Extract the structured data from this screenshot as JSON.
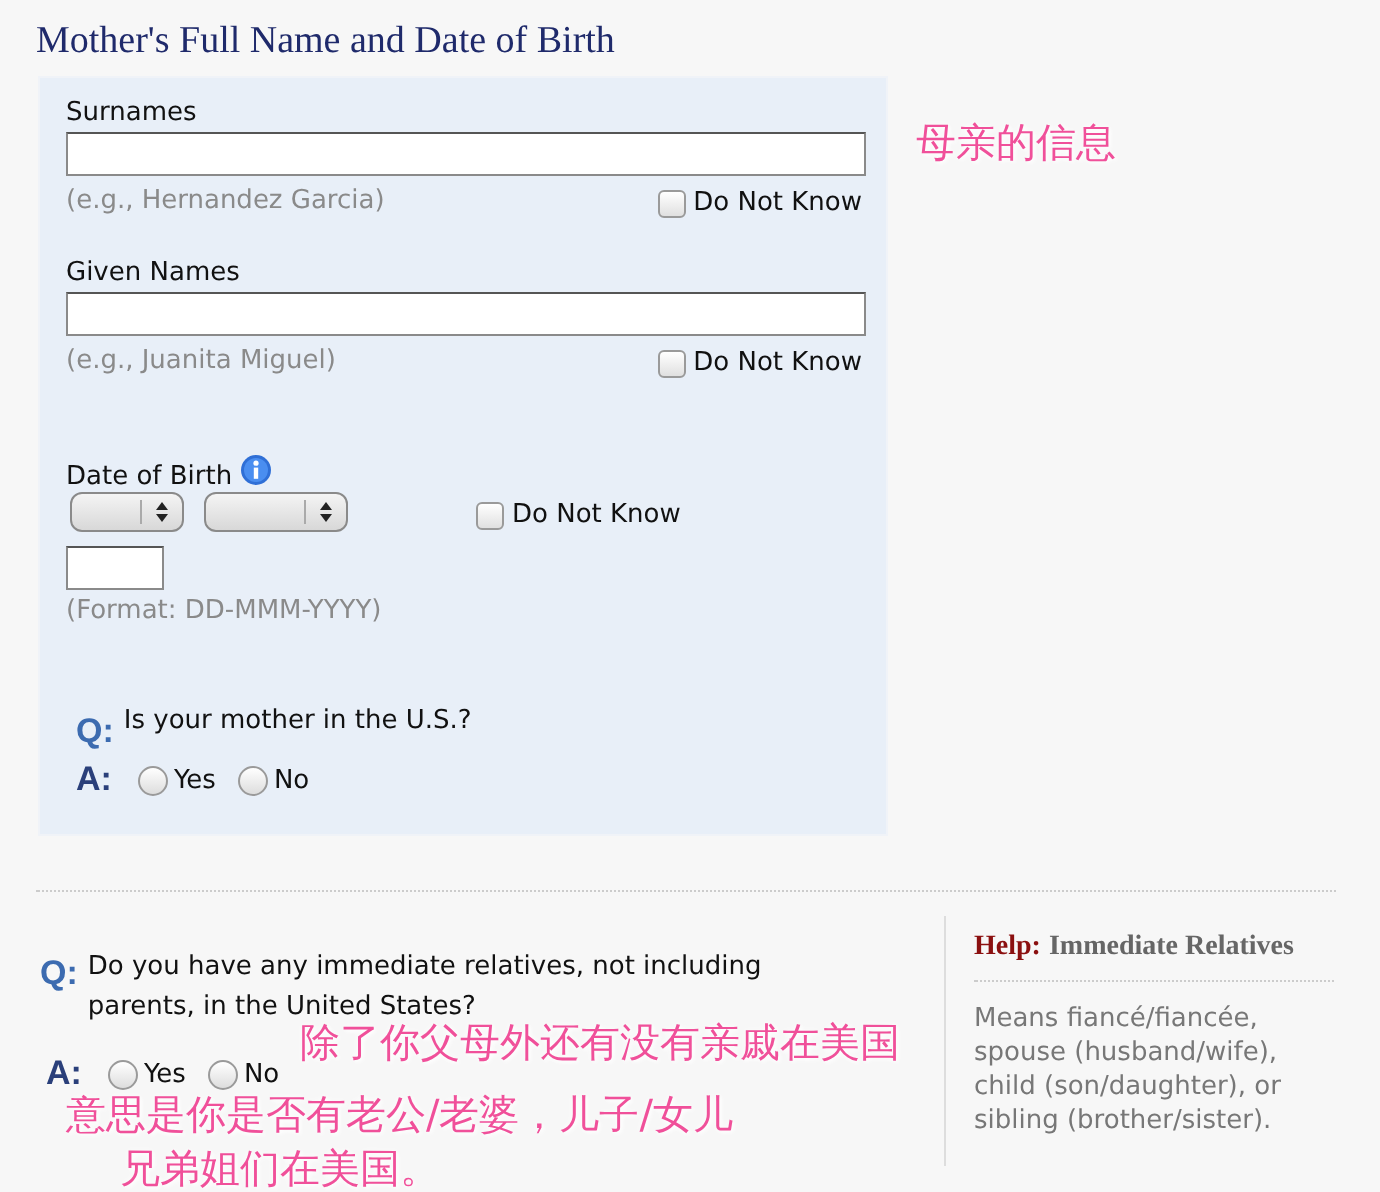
{
  "section_title": "Mother's Full Name and Date of Birth",
  "mother": {
    "fields": [
      {
        "label": "Surnames",
        "hint": "(e.g., Hernandez Garcia)",
        "dont_know": {
          "label": "Do Not Know",
          "checked": false
        }
      },
      {
        "label": "Given Names",
        "hint": "(e.g., Juanita Miguel)",
        "dont_know": {
          "label": "Do Not Know",
          "checked": false
        }
      }
    ],
    "dob": {
      "label": "Date of Birth",
      "dont_know": {
        "label": "Do Not Know",
        "checked": false
      },
      "format": "(Format: DD-MMM-YYYY)"
    },
    "question": {
      "q": "Q:",
      "text": "Is your mother in the U.S.?",
      "a": "A:",
      "options": [
        {
          "label": "Yes",
          "selected": false
        },
        {
          "label": "No",
          "selected": false
        }
      ]
    }
  },
  "relatives": {
    "question": {
      "q": "Q:",
      "text": "Do you have any immediate relatives, not including parents, in the United States?",
      "a": "A:",
      "options": [
        {
          "label": "Yes",
          "selected": false
        },
        {
          "label": "No",
          "selected": false
        }
      ]
    },
    "help": {
      "prefix": "Help:",
      "title": "Immediate Relatives",
      "text": "Means fiancé/fiancée, spouse (husband/wife), child (son/daughter), or sibling (brother/sister)."
    }
  },
  "annotations": [
    "母亲的信息",
    "除了你父母外还有没有亲戚在美国",
    "意思是你是否有老公/老婆，儿子/女儿",
    "兄弟姐们在美国。"
  ]
}
